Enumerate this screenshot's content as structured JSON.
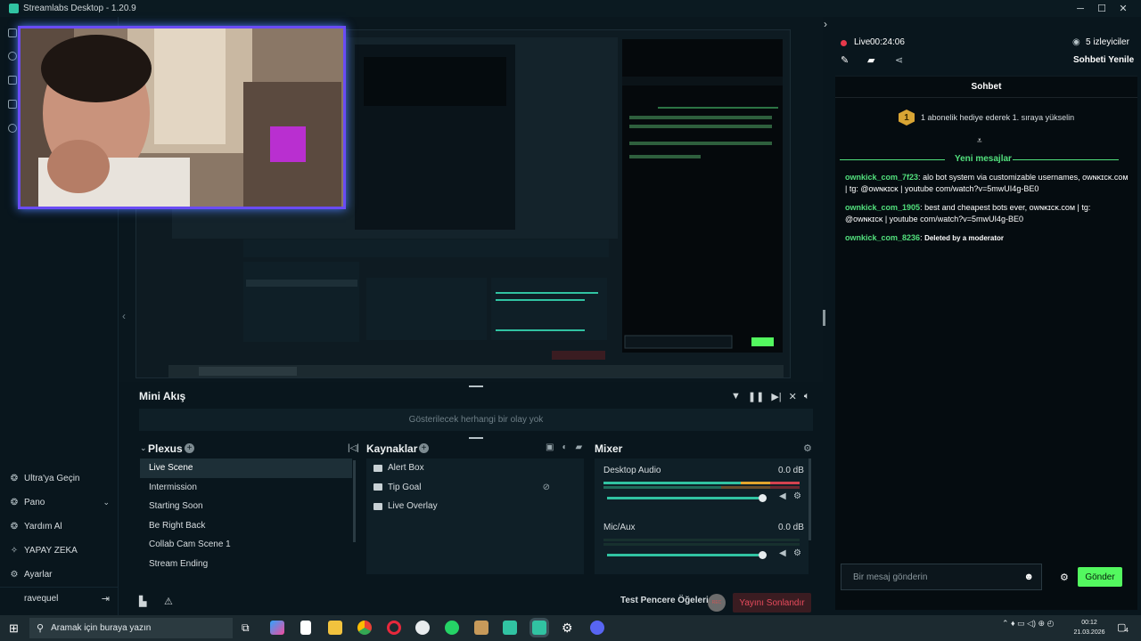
{
  "window": {
    "title": "Streamlabs Desktop - 1.20.9"
  },
  "sidebar": {
    "items": [
      {
        "label": "Ultra'ya Geçin",
        "icon": "ultra-icon"
      },
      {
        "label": "Pano",
        "icon": "dashboard-icon",
        "chevron": "⌄"
      },
      {
        "label": "Yardım Al",
        "icon": "help-icon"
      },
      {
        "label": "YAPAY ZEKA",
        "icon": "ai-icon"
      },
      {
        "label": "Ayarlar",
        "icon": "gear-icon"
      }
    ],
    "user": "ravequel"
  },
  "mini_feed": {
    "title": "Mini Akış",
    "empty_text": "Gösterilecek herhangi bir olay yok"
  },
  "scenes": {
    "title": "Plexus",
    "items": [
      "Live Scene",
      "Intermission",
      "Starting Soon",
      "Be Right Back",
      "Collab Cam Scene 1",
      "Stream Ending"
    ],
    "active": "Live Scene"
  },
  "sources": {
    "title": "Kaynaklar",
    "items": [
      {
        "label": "Alert Box",
        "icon": "alert-box-icon"
      },
      {
        "label": "Tip Goal",
        "icon": "tip-goal-icon"
      },
      {
        "label": "Live Overlay",
        "icon": "folder-icon"
      }
    ]
  },
  "mixer": {
    "title": "Mixer",
    "channels": [
      {
        "name": "Desktop Audio",
        "db": "0.0 dB",
        "level": 0.82,
        "volume": 0.96
      },
      {
        "name": "Mic/Aux",
        "db": "0.0 dB",
        "level": 0.0,
        "volume": 0.96
      }
    ]
  },
  "footer": {
    "test_label": "Test Pencere Öğeleri",
    "rec_label": "REC",
    "end_label": "Yayını Sonlandır"
  },
  "chat": {
    "live_label": "Live",
    "live_time": "00:24:06",
    "viewers": "5 izleyiciler",
    "refresh_label": "Sohbeti Yenile",
    "header": "Sohbet",
    "sub_badge": "1",
    "sub_text": "1 abonelik hediye ederek 1. sıraya yükselin",
    "new_messages": "Yeni mesajlar",
    "messages": [
      {
        "user": "ownkick_com_7f23",
        "text": "alo bot system via customizable usernames, ᴏᴡɴᴋɪᴄᴋ.ᴄᴏᴍ | tg: @ᴏᴡɴᴋɪᴄᴋ | youtube com/watch?v=5mwUI4g-BE0"
      },
      {
        "user": "ownkick_com_1905",
        "text": "best and cheapest bots ever, ᴏᴡɴᴋɪᴄᴋ.ᴄᴏᴍ | tg: @ᴏᴡɴᴋɪᴄᴋ | youtube com/watch?v=5mwUI4g-BE0"
      },
      {
        "user": "ownkick_com_8236",
        "text": "Deleted by a moderator"
      }
    ],
    "input_placeholder": "Bir mesaj gönderin",
    "send_label": "Gönder"
  },
  "taskbar": {
    "search_placeholder": "Aramak için buraya yazın",
    "time": "00:12",
    "date": "21.03.2026",
    "notifications": "4"
  },
  "colors": {
    "accent": "#31c3a2",
    "chat_user": "#52e07d",
    "live": "#e7394b",
    "send": "#53f85f"
  }
}
